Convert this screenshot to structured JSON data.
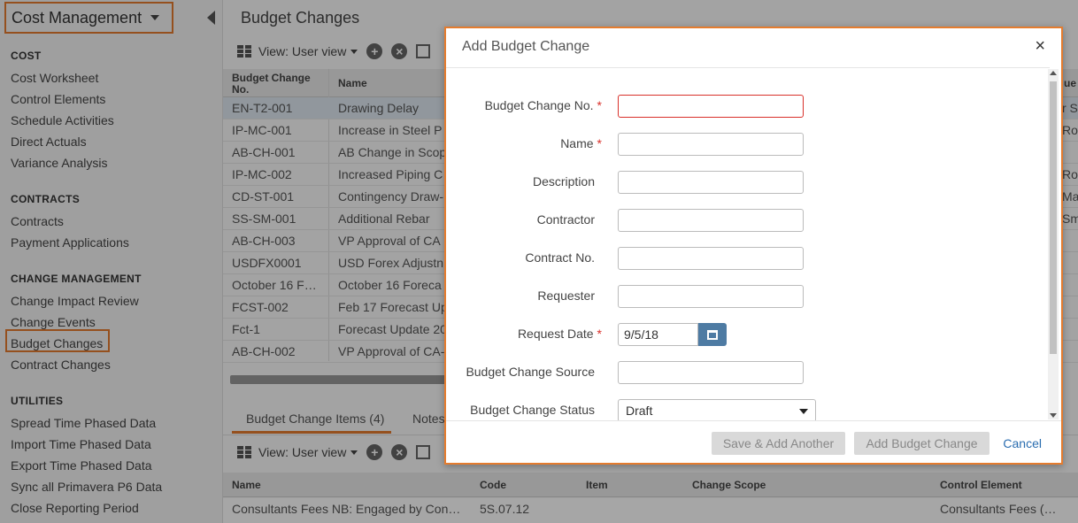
{
  "sidebar": {
    "app_title": "Cost Management",
    "sections": [
      {
        "title": "COST",
        "items": [
          "Cost Worksheet",
          "Control Elements",
          "Schedule Activities",
          "Direct Actuals",
          "Variance Analysis"
        ]
      },
      {
        "title": "CONTRACTS",
        "items": [
          "Contracts",
          "Payment Applications"
        ]
      },
      {
        "title": "CHANGE MANAGEMENT",
        "items": [
          "Change Impact Review",
          "Change Events",
          "Budget Changes",
          "Contract Changes"
        ]
      },
      {
        "title": "UTILITIES",
        "items": [
          "Spread Time Phased Data",
          "Import Time Phased Data",
          "Export Time Phased Data",
          "Sync all Primavera P6 Data",
          "Close Reporting Period"
        ]
      }
    ],
    "active_item": "Budget Changes"
  },
  "main": {
    "page_title": "Budget Changes",
    "toolbar": {
      "view_label": "View: User view"
    },
    "grid": {
      "columns": [
        "Budget Change No.",
        "Name"
      ],
      "rows": [
        {
          "no": "EN-T2-001",
          "name": "Drawing Delay",
          "tail": "r S"
        },
        {
          "no": "IP-MC-001",
          "name": "Increase in Steel P",
          "tail": "Ro"
        },
        {
          "no": "AB-CH-001",
          "name": "AB Change in Scop",
          "tail": ""
        },
        {
          "no": "IP-MC-002",
          "name": "Increased Piping C",
          "tail": "Ro"
        },
        {
          "no": "CD-ST-001",
          "name": "Contingency Draw-",
          "tail": "Ma"
        },
        {
          "no": "SS-SM-001",
          "name": "Additional Rebar",
          "tail": "Sm"
        },
        {
          "no": "AB-CH-003",
          "name": "VP Approval of CA",
          "tail": ""
        },
        {
          "no": "USDFX0001",
          "name": "USD Forex Adjustn",
          "tail": ""
        },
        {
          "no": "October 16 F…",
          "name": "October 16 Foreca",
          "tail": ""
        },
        {
          "no": "FCST-002",
          "name": "Feb 17 Forecast Up",
          "tail": ""
        },
        {
          "no": "Fct-1",
          "name": "Forecast Update 20",
          "tail": ""
        },
        {
          "no": "AB-CH-002",
          "name": "VP Approval of CA-",
          "tail": ""
        }
      ],
      "right_header": "ue"
    },
    "bottom_tabs": [
      "Budget Change Items (4)",
      "Notes"
    ],
    "items_toolbar": {
      "view_label": "View: User view"
    },
    "items_grid": {
      "columns": [
        "Name",
        "Code",
        "Item",
        "Change Scope",
        "Control Element"
      ],
      "row": {
        "name": "Consultants Fees NB: Engaged by Con…",
        "code": "5S.07.12",
        "item": "",
        "scope": "",
        "control": "Consultants Fees (…"
      }
    }
  },
  "modal": {
    "title": "Add Budget Change",
    "fields": [
      {
        "label": "Budget Change No.",
        "required": true,
        "value": ""
      },
      {
        "label": "Name",
        "required": true,
        "value": ""
      },
      {
        "label": "Description",
        "required": false,
        "value": ""
      },
      {
        "label": "Contractor",
        "required": false,
        "value": ""
      },
      {
        "label": "Contract No.",
        "required": false,
        "value": ""
      },
      {
        "label": "Requester",
        "required": false,
        "value": ""
      },
      {
        "label": "Request Date",
        "required": true,
        "value": "9/5/18"
      },
      {
        "label": "Budget Change Source",
        "required": false,
        "value": ""
      },
      {
        "label": "Budget Change Status",
        "required": false,
        "value": "Draft"
      }
    ],
    "buttons": {
      "save_add_another": "Save & Add Another",
      "add": "Add Budget Change",
      "cancel": "Cancel"
    },
    "required_marker": "*"
  },
  "colors": {
    "accent": "#e57c2e",
    "primary": "#4e7ba3",
    "link": "#2a6db0",
    "required": "#d9302a"
  },
  "icons": [
    "chevron-down-icon",
    "collapse-left-icon",
    "grid-icon",
    "add-icon",
    "delete-icon",
    "copy-icon",
    "calendar-icon",
    "close-icon"
  ]
}
